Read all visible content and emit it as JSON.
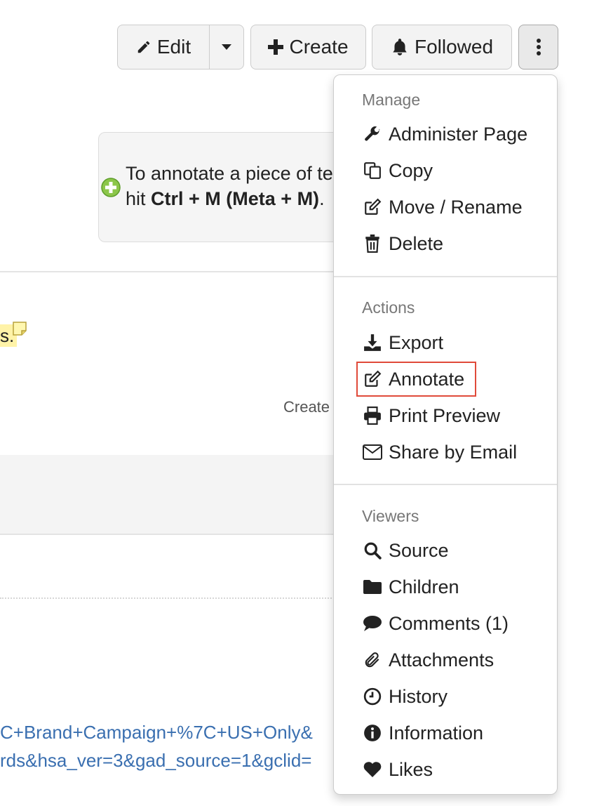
{
  "toolbar": {
    "edit_label": "Edit",
    "create_label": "Create",
    "followed_label": "Followed"
  },
  "info_box": {
    "line1": "To annotate a piece of te",
    "line2_prefix": "hit ",
    "line2_bold": "Ctrl + M (Meta + M)",
    "line2_suffix": "."
  },
  "page": {
    "highlight_text": "s.",
    "created_text": "Create",
    "url_line1": "C+Brand+Campaign+%7C+US+Only&",
    "url_line2": "rds&hsa_ver=3&gad_source=1&gclid="
  },
  "menu": {
    "sections": [
      {
        "header": "Manage",
        "items": [
          {
            "label": "Administer Page",
            "icon": "wrench-icon"
          },
          {
            "label": "Copy",
            "icon": "copy-icon"
          },
          {
            "label": "Move / Rename",
            "icon": "edit-icon"
          },
          {
            "label": "Delete",
            "icon": "trash-icon"
          }
        ]
      },
      {
        "header": "Actions",
        "items": [
          {
            "label": "Export",
            "icon": "download-icon"
          },
          {
            "label": "Annotate",
            "icon": "edit-icon"
          },
          {
            "label": "Print Preview",
            "icon": "print-icon"
          },
          {
            "label": "Share by Email",
            "icon": "envelope-icon"
          }
        ]
      },
      {
        "header": "Viewers",
        "items": [
          {
            "label": "Source",
            "icon": "search-icon"
          },
          {
            "label": "Children",
            "icon": "folder-icon"
          },
          {
            "label": "Comments (1)",
            "icon": "comment-icon"
          },
          {
            "label": "Attachments",
            "icon": "paperclip-icon"
          },
          {
            "label": "History",
            "icon": "clock-icon"
          },
          {
            "label": "Information",
            "icon": "info-icon"
          },
          {
            "label": "Likes",
            "icon": "heart-icon"
          }
        ]
      }
    ]
  },
  "colors": {
    "link": "#3a6fb0",
    "highlight": "#fff3a8",
    "annotate_outline": "#e04a3a"
  }
}
